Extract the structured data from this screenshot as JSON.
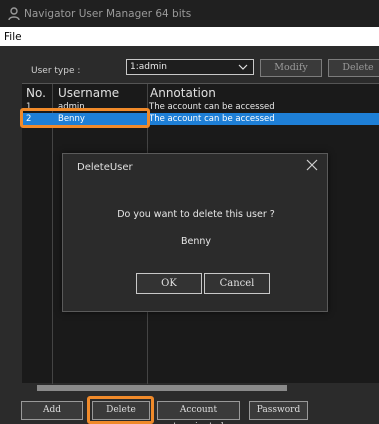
{
  "window": {
    "title": "Navigator User Manager 64 bits",
    "app_icon": "person-icon"
  },
  "menu": {
    "file_label": "File"
  },
  "usertype": {
    "label": "User type :",
    "selected": "1:admin"
  },
  "toolbar": {
    "modify_label": "Modify",
    "delete_label": "Delete"
  },
  "table": {
    "headers": {
      "no": "No.",
      "username": "Username",
      "annotation": "Annotation"
    },
    "rows": [
      {
        "no": "1",
        "username": "admin",
        "annotation": "The account can be accessed"
      },
      {
        "no": "2",
        "username": "Benny",
        "annotation": "The account can be accessed",
        "selected": true
      }
    ]
  },
  "bottom": {
    "add_label": "Add",
    "delete_label": "Delete",
    "terminated_label": "Account terminated",
    "password_label": "Password"
  },
  "dialog": {
    "title": "DeleteUser",
    "message": "Do you want to delete this user ?",
    "username": "Benny",
    "ok_label": "OK",
    "cancel_label": "Cancel"
  },
  "colors": {
    "selection": "#1e7fd6",
    "highlight": "#f08a2a",
    "background": "#2b2b2b"
  }
}
